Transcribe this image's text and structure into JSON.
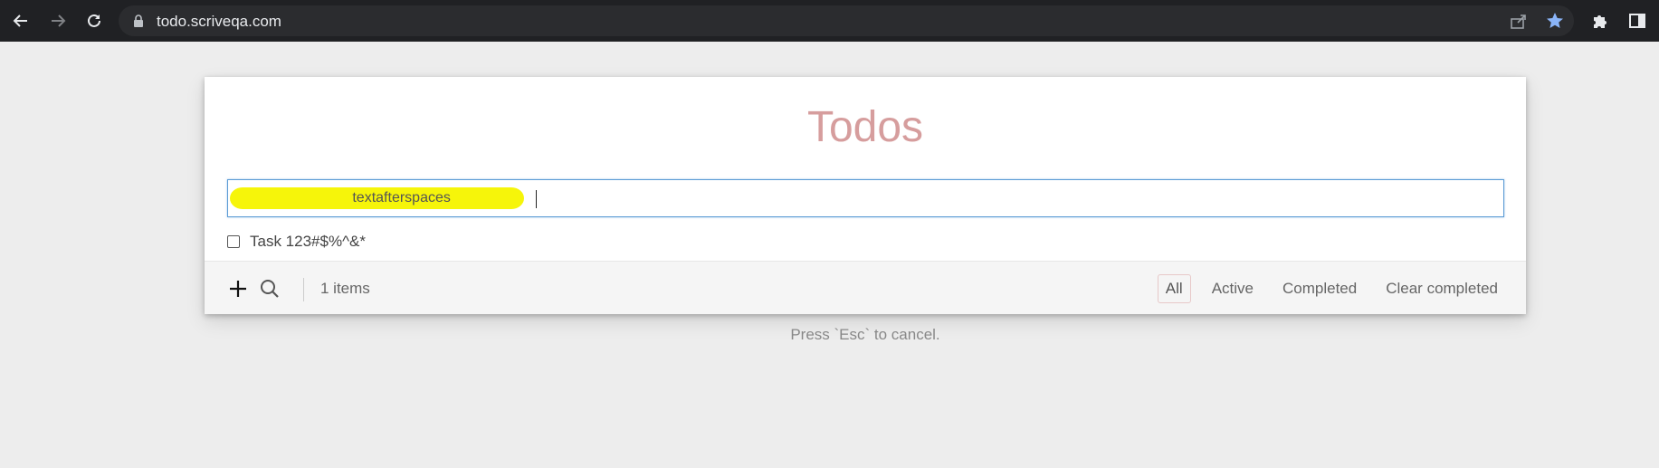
{
  "browser": {
    "url": "todo.scriveqa.com"
  },
  "app": {
    "title": "Todos",
    "new_todo_value": "                              textafterspaces",
    "todos": [
      {
        "label": "Task 123#$%^&*",
        "completed": false
      }
    ],
    "footer": {
      "count": "1 items",
      "filters": [
        "All",
        "Active",
        "Completed"
      ],
      "clear_completed": "Clear completed",
      "selected_filter": "All"
    },
    "hint": "Press `Esc` to cancel."
  },
  "colors": {
    "title": "#d69d9d",
    "highlight": "#f6f50a",
    "input_border": "#5b9bd5",
    "star": "#8ab4f8"
  },
  "icons": {
    "back": "arrow-left-icon",
    "forward": "arrow-right-icon",
    "reload": "reload-icon",
    "lock": "lock-icon",
    "share": "share-icon",
    "bookmark": "star-icon",
    "extensions": "puzzle-icon",
    "side_panel": "side-panel-icon",
    "add": "plus-icon",
    "search": "search-icon"
  }
}
